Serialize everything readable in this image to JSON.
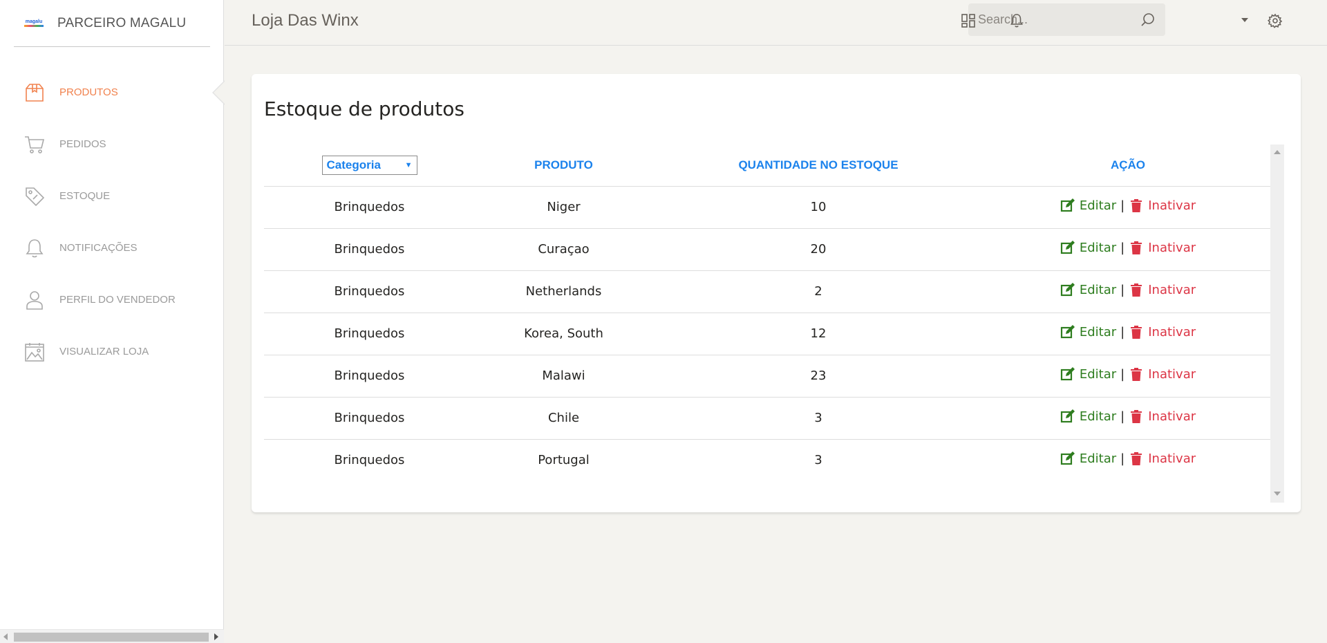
{
  "sidebar": {
    "logo_text": "magalu",
    "brand": "PARCEIRO MAGALU",
    "items": [
      {
        "label": "PRODUTOS",
        "icon": "package-icon",
        "active": true
      },
      {
        "label": "PEDIDOS",
        "icon": "cart-icon",
        "active": false
      },
      {
        "label": "ESTOQUE",
        "icon": "tag-icon",
        "active": false
      },
      {
        "label": "NOTIFICAÇÕES",
        "icon": "bell-icon",
        "active": false
      },
      {
        "label": "PERFIL DO VENDEDOR",
        "icon": "user-icon",
        "active": false
      },
      {
        "label": "VISUALIZAR LOJA",
        "icon": "image-icon",
        "active": false
      }
    ]
  },
  "header": {
    "title": "Loja Das Winx",
    "search_placeholder": "Search...",
    "icons": [
      "search-icon",
      "dashboard-icon",
      "bell-icon",
      "gear-icon"
    ]
  },
  "main": {
    "card_title": "Estoque de produtos",
    "filter": {
      "selected": "Categoria"
    },
    "columns": [
      "PRODUTO",
      "QUANTIDADE NO ESTOQUE",
      "AÇÃO"
    ],
    "actions": {
      "edit_label": "Editar",
      "separator": "|",
      "delete_label": "Inativar"
    },
    "rows": [
      {
        "categoria": "Brinquedos",
        "produto": "Niger",
        "quantidade": "10"
      },
      {
        "categoria": "Brinquedos",
        "produto": "Curaçao",
        "quantidade": "20"
      },
      {
        "categoria": "Brinquedos",
        "produto": "Netherlands",
        "quantidade": "2"
      },
      {
        "categoria": "Brinquedos",
        "produto": "Korea, South",
        "quantidade": "12"
      },
      {
        "categoria": "Brinquedos",
        "produto": "Malawi",
        "quantidade": "23"
      },
      {
        "categoria": "Brinquedos",
        "produto": "Chile",
        "quantidade": "3"
      },
      {
        "categoria": "Brinquedos",
        "produto": "Portugal",
        "quantidade": "3"
      }
    ]
  },
  "colors": {
    "accent": "#f1824e",
    "link_blue": "#1b82ec",
    "edit_green": "#2e7d1f",
    "delete_red": "#dc3545"
  }
}
